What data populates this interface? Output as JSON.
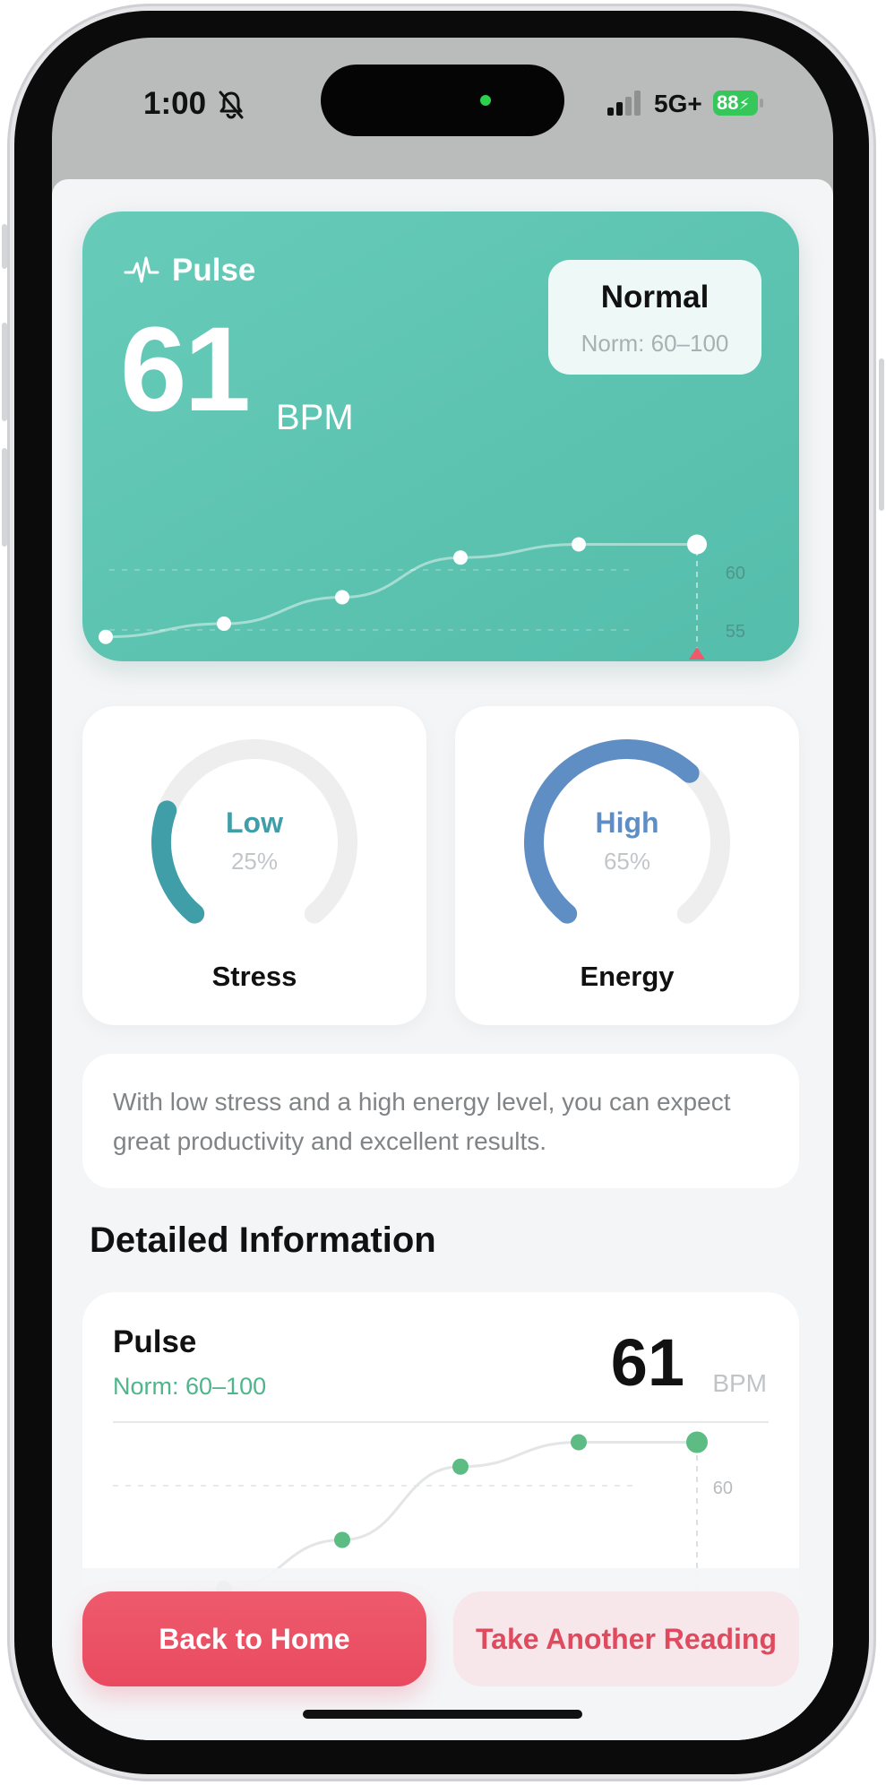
{
  "status_bar": {
    "time": "1:00",
    "network": "5G+",
    "battery": "88"
  },
  "hero": {
    "label": "Pulse",
    "value": "61",
    "unit": "BPM",
    "status": "Normal",
    "norm": "Norm: 60–100",
    "axis_labels": [
      "60",
      "55"
    ]
  },
  "stress": {
    "title": "Stress",
    "level": "Low",
    "percent_label": "25%",
    "percent": 25,
    "color": "#3f9ea8"
  },
  "energy": {
    "title": "Energy",
    "level": "High",
    "percent_label": "65%",
    "percent": 65,
    "color": "#5f8ec4"
  },
  "insight": {
    "text": "With low stress and a high energy level, you can expect great productivity and excellent results."
  },
  "details": {
    "section_title": "Detailed Information",
    "pulse": {
      "title": "Pulse",
      "norm": "Norm: 60–100",
      "value": "61",
      "unit": "BPM",
      "axis_label": "60"
    }
  },
  "actions": {
    "back_label": "Back to Home",
    "retake_label": "Take Another Reading"
  },
  "colors": {
    "teal": "#5cc3b0",
    "accent_red": "#e94a5f",
    "green": "#5dbb84"
  },
  "chart_data": {
    "type": "line",
    "x": [
      1,
      2,
      3,
      4,
      5,
      6
    ],
    "values": [
      54,
      55,
      57,
      60,
      61,
      61
    ],
    "ylim": [
      51,
      63
    ],
    "yticks": [
      60,
      55
    ]
  }
}
